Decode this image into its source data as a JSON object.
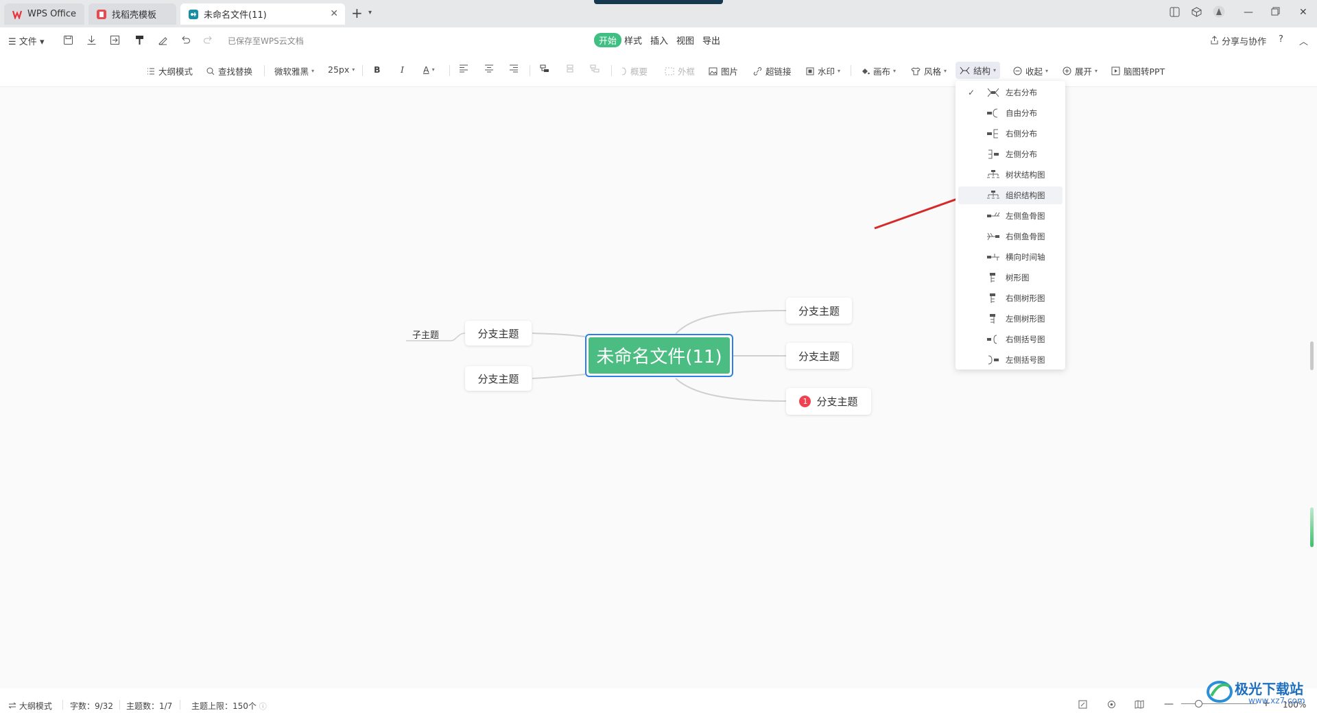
{
  "titlebar": {
    "tabs": [
      {
        "label": "WPS Office",
        "icon": "wps-logo-icon"
      },
      {
        "label": "找稻壳模板",
        "icon": "docer-icon"
      },
      {
        "label": "未命名文件(11)",
        "icon": "mindmap-file-icon"
      }
    ]
  },
  "menubar": {
    "file_label": "文件",
    "saved_status": "已保存至WPS云文档",
    "tabs": [
      "开始",
      "样式",
      "插入",
      "视图",
      "导出"
    ],
    "share_label": "分享与协作"
  },
  "toolbar": {
    "outline_mode": "大纲模式",
    "find_replace": "查找替换",
    "font_family": "微软雅黑",
    "font_size": "25px",
    "bold": "B",
    "italic": "I",
    "font_color": "A",
    "summary": "概要",
    "boundary": "外框",
    "image": "图片",
    "hyperlink": "超链接",
    "watermark": "水印",
    "canvas": "画布",
    "style": "风格",
    "structure": "结构",
    "collapse": "收起",
    "expand": "展开",
    "to_ppt": "脑图转PPT"
  },
  "mindmap": {
    "root": "未命名文件(11)",
    "left_branches": [
      "分支主题",
      "分支主题"
    ],
    "child_topic": "子主题",
    "right_branches": [
      "分支主题",
      "分支主题",
      "分支主题"
    ],
    "badge_number": "1"
  },
  "structure_menu": {
    "selected_index": 0,
    "hover_index": 5,
    "items": [
      "左右分布",
      "自由分布",
      "右侧分布",
      "左侧分布",
      "树状结构图",
      "组织结构图",
      "左侧鱼骨图",
      "右侧鱼骨图",
      "横向时间轴",
      "树形图",
      "右侧树形图",
      "左侧树形图",
      "右侧括号图",
      "左侧括号图"
    ]
  },
  "statusbar": {
    "outline_mode": "大纲模式",
    "word_count": "字数：9/32",
    "topic_count": "主题数：1/7",
    "topic_limit": "主题上限：150个",
    "zoom": "100%"
  },
  "watermark_site": {
    "name": "极光下载站",
    "url": "www.xz7.com"
  },
  "colors": {
    "root_fill": "#4cbd82",
    "selection_border": "#2b7de9",
    "active_tab": "#3fbf82",
    "arrow": "#d42a2a",
    "badge": "#f0424e"
  }
}
